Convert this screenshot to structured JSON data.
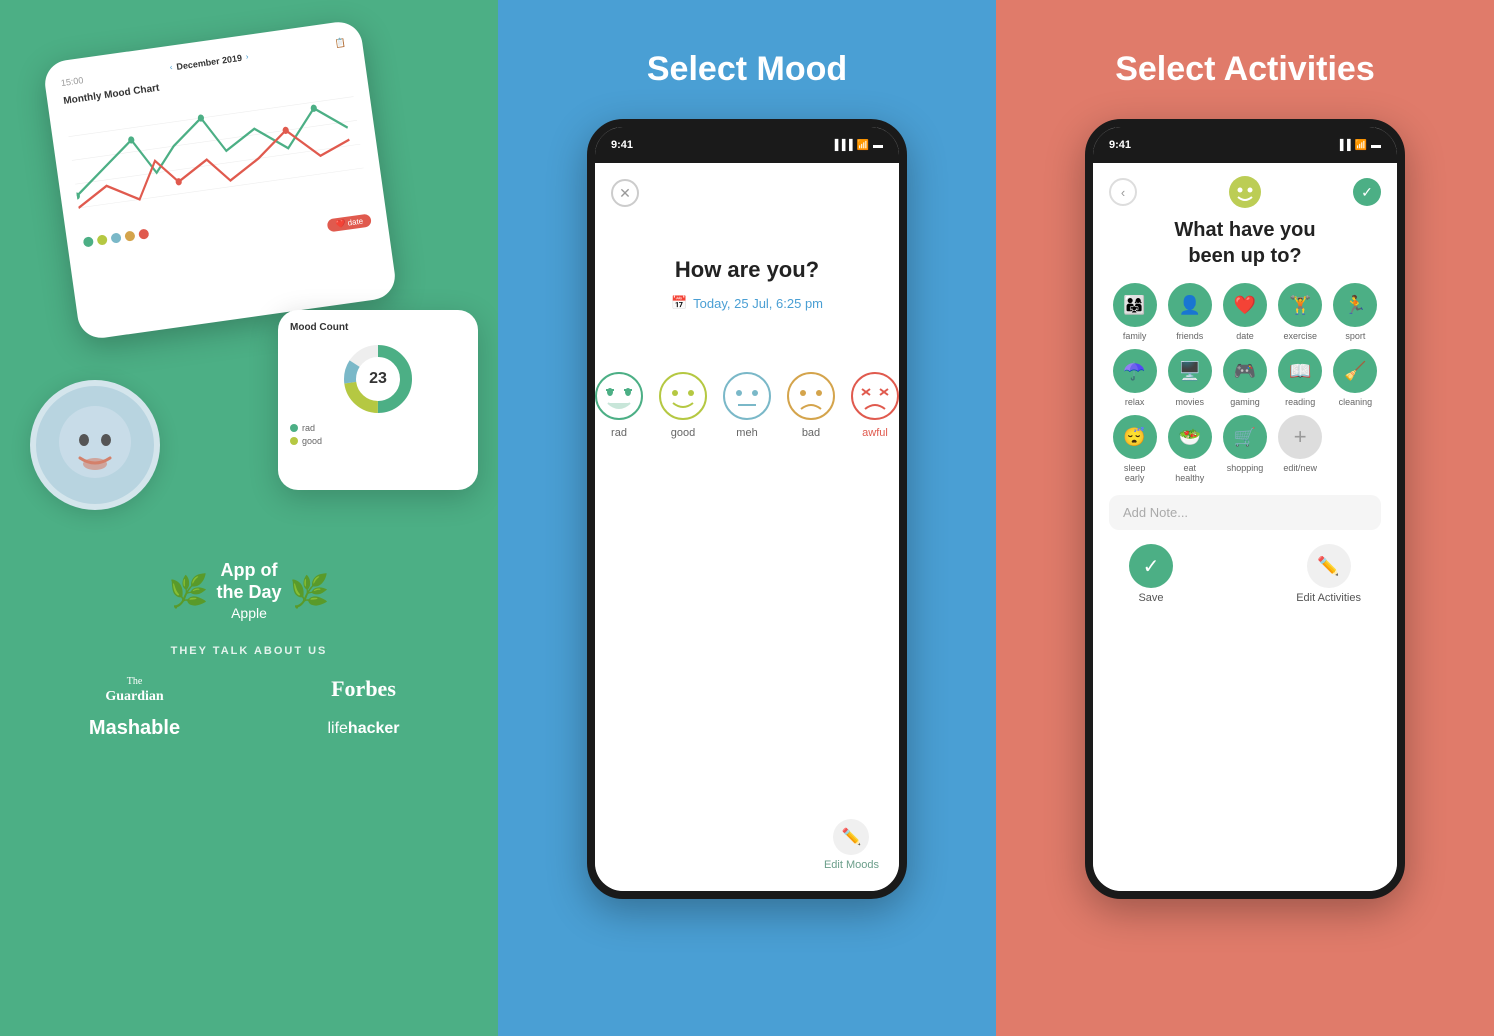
{
  "panel1": {
    "background_color": "#4caf85",
    "award": {
      "line1": "App of",
      "line2": "the Day",
      "brand": "Apple"
    },
    "press_label": "THEY TALK ABOUT US",
    "press_logos": [
      "The Guardian",
      "Forbes",
      "Mashable",
      "lifehacker"
    ],
    "chart_title": "Monthly Mood Chart",
    "chart_period": "December 2019",
    "mood_count_title": "Mood Count"
  },
  "panel2": {
    "background_color": "#4a9fd4",
    "title": "Select Mood",
    "status_time": "9:41",
    "close_label": "✕",
    "question": "How are you?",
    "date_label": "Today, 25 Jul, 6:25 pm",
    "moods": [
      {
        "label": "rad",
        "color": "#4caf85"
      },
      {
        "label": "good",
        "color": "#b5c842"
      },
      {
        "label": "meh",
        "color": "#7ab8c8"
      },
      {
        "label": "bad",
        "color": "#d4a44c"
      },
      {
        "label": "awful",
        "color": "#e05a4e"
      }
    ],
    "edit_moods_label": "Edit Moods"
  },
  "panel3": {
    "background_color": "#e07b6a",
    "title": "Select Activities",
    "status_time": "9:41",
    "question": "What have you\nbeen up to?",
    "activities": [
      {
        "label": "family",
        "icon": "👨‍👩‍👧"
      },
      {
        "label": "friends",
        "icon": "👤"
      },
      {
        "label": "date",
        "icon": "❤️"
      },
      {
        "label": "exercise",
        "icon": "🏃"
      },
      {
        "label": "sport",
        "icon": "🏃"
      },
      {
        "label": "relax",
        "icon": "☂️"
      },
      {
        "label": "movies",
        "icon": "🖥️"
      },
      {
        "label": "gaming",
        "icon": "🎮"
      },
      {
        "label": "reading",
        "icon": "📖"
      },
      {
        "label": "cleaning",
        "icon": "🧹"
      },
      {
        "label": "sleep early",
        "icon": "😴"
      },
      {
        "label": "eat healthy",
        "icon": "🥗"
      },
      {
        "label": "shopping",
        "icon": "🛒"
      },
      {
        "label": "edit/new",
        "icon": "+"
      }
    ],
    "add_note_placeholder": "Add Note...",
    "save_label": "Save",
    "edit_activities_label": "Edit Activities"
  }
}
